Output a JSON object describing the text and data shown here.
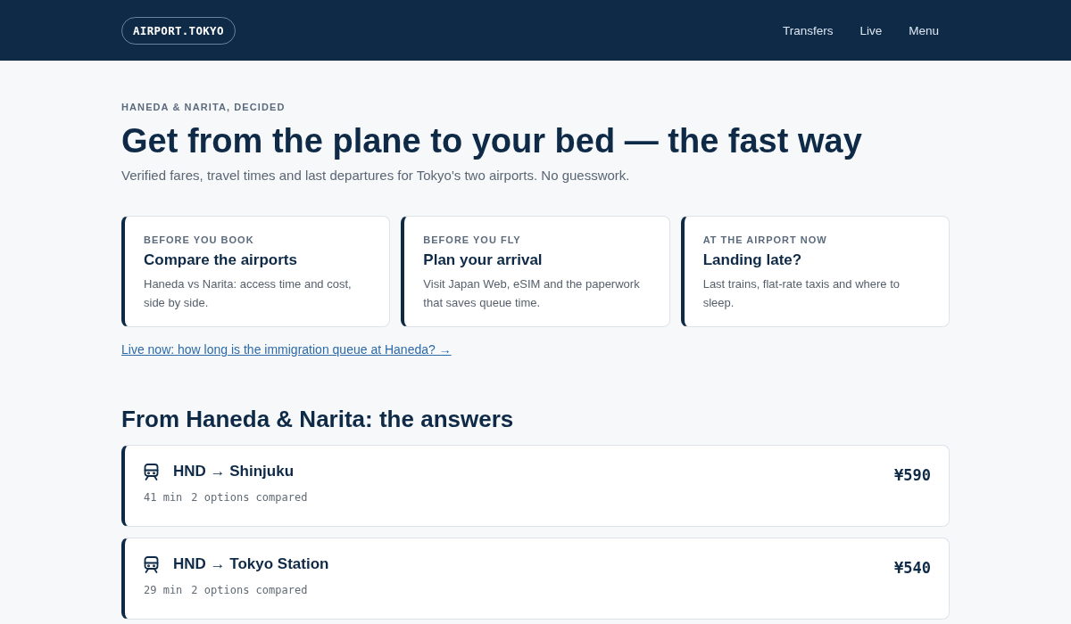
{
  "header": {
    "logo": "AIRPORT.TOKYO",
    "nav": [
      "Transfers",
      "Live",
      "Menu"
    ]
  },
  "hero": {
    "eyebrow": "HANEDA & NARITA, DECIDED",
    "title": "Get from the plane to your bed — the fast way",
    "subtitle": "Verified fares, travel times and last departures for Tokyo's two airports. No guesswork."
  },
  "cards": [
    {
      "eyebrow": "BEFORE YOU BOOK",
      "title": "Compare the airports",
      "text": "Haneda vs Narita: access time and cost, side by side."
    },
    {
      "eyebrow": "BEFORE YOU FLY",
      "title": "Plan your arrival",
      "text": "Visit Japan Web, eSIM and the paperwork that saves queue time."
    },
    {
      "eyebrow": "AT THE AIRPORT NOW",
      "title": "Landing late?",
      "text": "Last trains, flat-rate taxis and where to sleep."
    }
  ],
  "live_link": "Live now: how long is the immigration queue at Haneda? →",
  "answers": {
    "title": "From Haneda & Narita: the answers",
    "routes": [
      {
        "title": "HND → Shinjuku",
        "time": "41 min",
        "options": "2 options compared",
        "price": "¥590"
      },
      {
        "title": "HND → Tokyo Station",
        "time": "29 min",
        "options": "2 options compared",
        "price": "¥540"
      }
    ]
  }
}
